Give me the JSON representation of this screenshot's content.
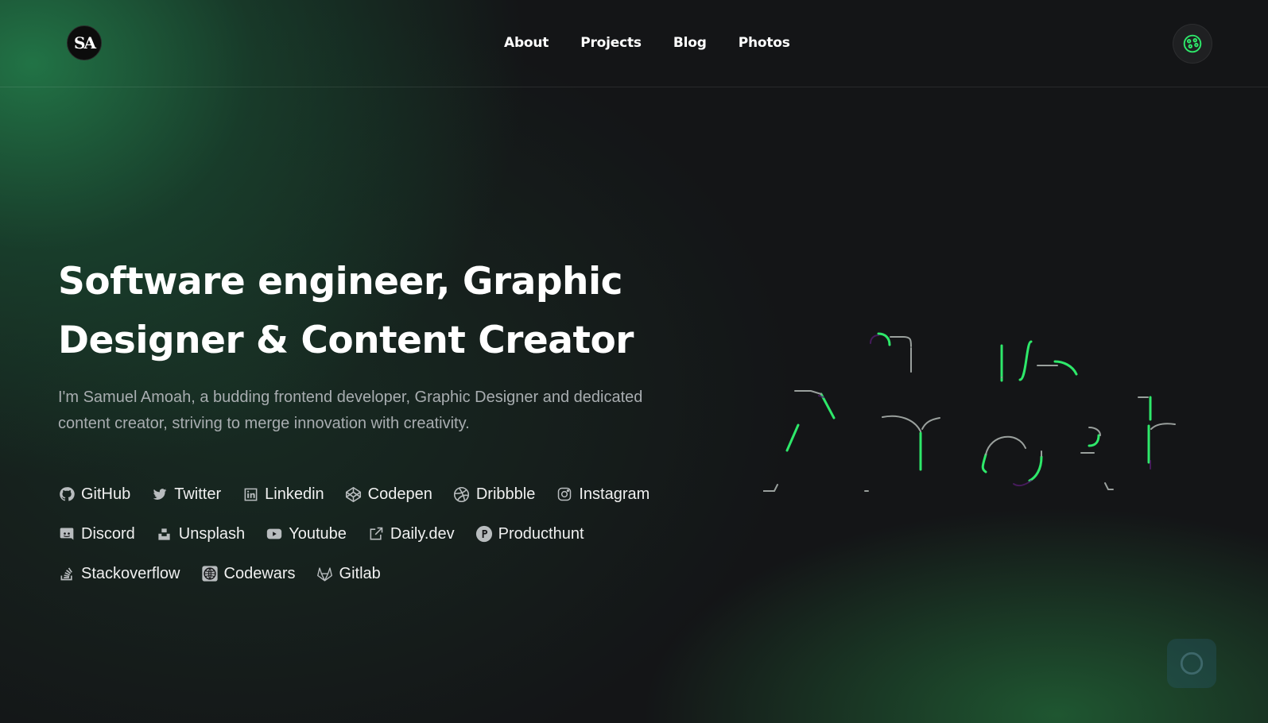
{
  "logo": {
    "text": "SA"
  },
  "nav": {
    "items": [
      {
        "label": "About"
      },
      {
        "label": "Projects"
      },
      {
        "label": "Blog"
      },
      {
        "label": "Photos"
      }
    ]
  },
  "hero": {
    "title": "Software engineer, Graphic Designer & Content Creator",
    "description": "I'm Samuel Amoah, a budding frontend developer, Graphic Designer and dedicated content creator, striving to merge innovation with creativity."
  },
  "social_links": {
    "row1": [
      {
        "label": "GitHub",
        "icon": "github-icon"
      },
      {
        "label": "Twitter",
        "icon": "twitter-icon"
      },
      {
        "label": "Linkedin",
        "icon": "linkedin-icon"
      },
      {
        "label": "Codepen",
        "icon": "codepen-icon"
      },
      {
        "label": "Dribbble",
        "icon": "dribbble-icon"
      },
      {
        "label": "Instagram",
        "icon": "instagram-icon"
      }
    ],
    "row2": [
      {
        "label": "Discord",
        "icon": "discord-icon"
      },
      {
        "label": "Unsplash",
        "icon": "unsplash-icon"
      },
      {
        "label": "Youtube",
        "icon": "youtube-icon"
      },
      {
        "label": "Daily.dev",
        "icon": "external-link-icon"
      },
      {
        "label": "Producthunt",
        "icon": "producthunt-icon"
      }
    ],
    "row3": [
      {
        "label": "Stackoverflow",
        "icon": "stackoverflow-icon"
      },
      {
        "label": "Codewars",
        "icon": "codewars-icon"
      },
      {
        "label": "Gitlab",
        "icon": "gitlab-icon"
      }
    ]
  },
  "colors": {
    "accent": "#2ee86a",
    "background": "#141517",
    "text": "#ffffff",
    "muted_text": "#a8adb0"
  }
}
